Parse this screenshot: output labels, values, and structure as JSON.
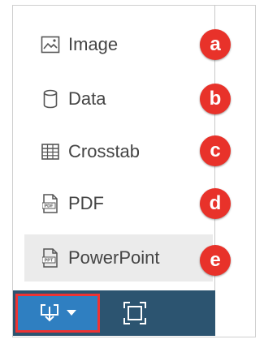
{
  "menu": {
    "items": [
      {
        "label": "Image",
        "badge": "a",
        "icon": "image-icon"
      },
      {
        "label": "Data",
        "badge": "b",
        "icon": "database-icon"
      },
      {
        "label": "Crosstab",
        "badge": "c",
        "icon": "table-icon"
      },
      {
        "label": "PDF",
        "badge": "d",
        "icon": "pdf-file-icon"
      },
      {
        "label": "PowerPoint",
        "badge": "e",
        "icon": "ppt-file-icon"
      }
    ]
  },
  "toolbar": {
    "download_icon": "download-icon",
    "dropdown_icon": "caret-down-icon",
    "fullscreen_icon": "fullscreen-icon"
  },
  "colors": {
    "badge": "#e8322a",
    "toolbar_bg": "#2c5470",
    "download_bg": "#2f7fc1",
    "highlight_border": "#e33333",
    "hover_bg": "#ebebeb"
  }
}
